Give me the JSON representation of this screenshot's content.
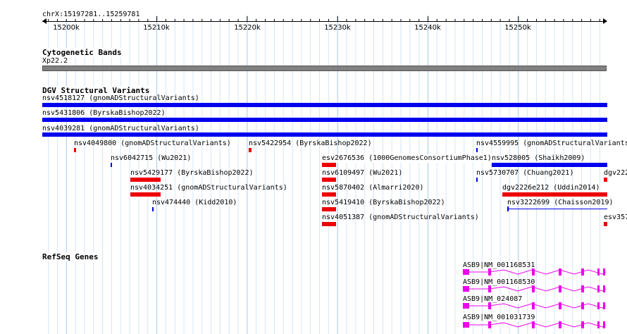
{
  "ruler": {
    "coords": "chrX:15197281..15259781",
    "ticks": [
      "15200k",
      "15210k",
      "15220k",
      "15230k",
      "15240k",
      "15250k"
    ]
  },
  "cyto": {
    "title": "Cytogenetic Bands",
    "band": "Xp22.2",
    "color": "#808080"
  },
  "dgv": {
    "title": "DGV Structural Variants",
    "features": [
      "nsv4518127 (gnomADStructuralVariants)",
      "nsv5431806 (ByrskaBishop2022)",
      "nsv4039281 (gnomADStructuralVariants)",
      "nsv4049800 (gnomADStructuralVariants)",
      "nsv5422954 (ByrskaBishop2022)",
      "nsv4559995 (gnomADStructuralVariants)",
      "nsv6042715 (Wu2021)",
      "esv2676536 (1000GenomesConsortiumPhase1)",
      "nsv528005 (Shaikh2009)",
      "nsv5429177 (ByrskaBishop2022)",
      "nsv6109497 (Wu2021)",
      "nsv5730707 (Chuang2021)",
      "dgv222",
      "nsv4034251 (gnomADStructuralVariants)",
      "nsv5870402 (Almarri2020)",
      "dgv2226e212 (Uddin2014)",
      "nsv474440 (Kidd2010)",
      "nsv5419410 (ByrskaBishop2022)",
      "nsv3222699 (Chaisson2019)",
      "nsv4051387 (gnomADStructuralVariants)",
      "esv357"
    ],
    "colors": {
      "gain": "#0000ee",
      "loss": "#ee0000"
    }
  },
  "refseq": {
    "title": "RefSeq Genes",
    "transcripts": [
      "ASB9|NM_001168531",
      "ASB9|NM_001168530",
      "ASB9|NM_024087",
      "ASB9|NM_001031739"
    ],
    "color": "#ee00ee"
  }
}
